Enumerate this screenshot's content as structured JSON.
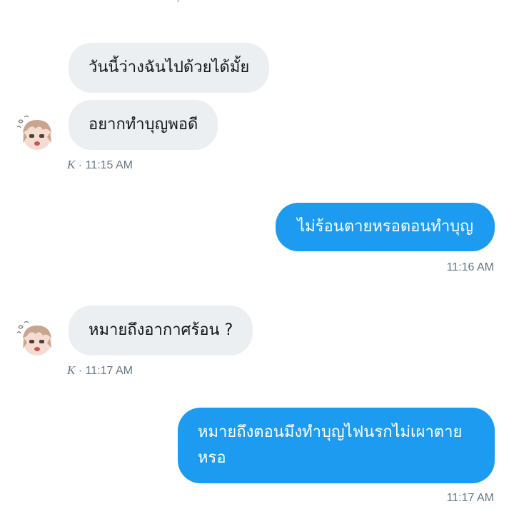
{
  "messages": [
    {
      "direction": "incoming",
      "text": "วันนี้ว่างฉันไปด้วยได้มั้ย"
    },
    {
      "direction": "incoming",
      "text": "อยากทำบุญพอดี"
    },
    {
      "direction": "outgoing",
      "text": "ไม่ร้อนตายหรอตอนทำบุญ"
    },
    {
      "direction": "incoming",
      "text": "หมายถึงอากาศร้อน ?"
    },
    {
      "direction": "outgoing",
      "lines": [
        "หมายถึงตอนมึงทำบุญไฟนรกไม่เผาตาย",
        "หรอ"
      ]
    }
  ],
  "meta": [
    {
      "sender": "K",
      "separator": "·",
      "time": "11:15 AM"
    },
    {
      "time": "11:16 AM"
    },
    {
      "sender": "K",
      "separator": "·",
      "time": "11:17 AM"
    },
    {
      "time": "11:17 AM"
    }
  ],
  "colors": {
    "incoming_bubble": "#eceff1",
    "outgoing_bubble": "#1d9bf0",
    "meta_text": "#657786"
  },
  "icons": {
    "avatar": "anime-chibi-avatar-icon"
  }
}
